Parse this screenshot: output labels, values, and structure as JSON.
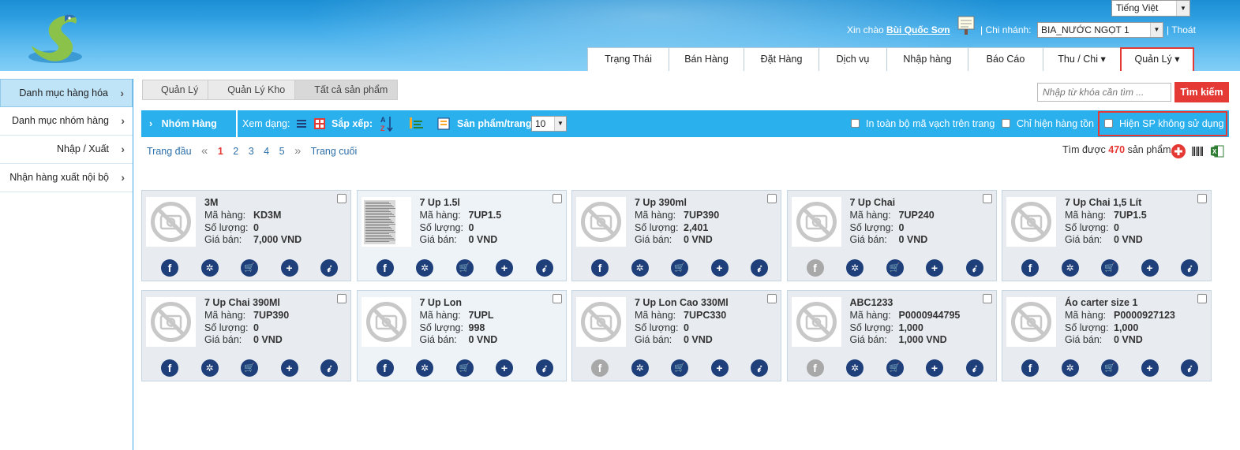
{
  "header": {
    "language": "Tiếng Việt",
    "greeting": "Xin chào",
    "user_name": "Bùi Quốc Sơn",
    "branch_label": "| Chi nhánh:",
    "branch_value": "BIA_NƯỚC NGỌT 1",
    "logout": "| Thoát"
  },
  "nav": {
    "tabs": [
      {
        "label": "Trạng Thái"
      },
      {
        "label": "Bán Hàng"
      },
      {
        "label": "Đặt Hàng"
      },
      {
        "label": "Dịch vụ"
      },
      {
        "label": "Nhập hàng"
      },
      {
        "label": "Báo Cáo"
      },
      {
        "label": "Thu / Chi ▾"
      },
      {
        "label": "Quản Lý ▾"
      }
    ]
  },
  "sidebar": {
    "items": [
      {
        "label": "Danh mục hàng hóa"
      },
      {
        "label": "Danh mục nhóm hàng"
      },
      {
        "label": "Nhập / Xuất"
      },
      {
        "label": "Nhận hàng xuất nội bộ"
      }
    ]
  },
  "breadcrumb": [
    "Quản Lý",
    "Quản Lý Kho",
    "Tất cả sản phẩm"
  ],
  "search": {
    "placeholder": "Nhập từ khóa cần tìm ...",
    "button": "Tìm kiếm"
  },
  "toolbar": {
    "group": "Nhóm Hàng",
    "view_label": "Xem dạng:",
    "sort_label": "Sắp xếp:",
    "per_page_label": "Sản phẩm/trang:",
    "per_page_value": "10",
    "print_all": "In toàn bộ mã vạch trên trang",
    "only_stock": "Chỉ hiện hàng tồn",
    "show_unused": "Hiện SP không sử dụng"
  },
  "pager": {
    "first": "Trang đầu",
    "prev": "«",
    "pages": [
      "1",
      "2",
      "3",
      "4",
      "5"
    ],
    "next": "»",
    "last": "Trang cuối"
  },
  "found": {
    "prefix": "Tìm được",
    "count": "470",
    "suffix": "sản phẩm"
  },
  "labels": {
    "code": "Mã hàng:",
    "qty": "Số lượng:",
    "price": "Giá bán:"
  },
  "products": [
    {
      "name": "3M",
      "code": "KD3M",
      "qty": "0",
      "price": "7,000 VND"
    },
    {
      "name": "7 Up 1.5l",
      "code": "7UP1.5",
      "qty": "0",
      "price": "0 VND"
    },
    {
      "name": "7 Up 390ml",
      "code": "7UP390",
      "qty": "2,401",
      "price": "0 VND"
    },
    {
      "name": "7 Up Chai",
      "code": "7UP240",
      "qty": "0",
      "price": "0 VND"
    },
    {
      "name": "7 Up Chai 1,5 Lít",
      "code": "7UP1.5",
      "qty": "0",
      "price": "0 VND"
    },
    {
      "name": "7 Up Chai 390Ml",
      "code": "7UP390",
      "qty": "0",
      "price": "0 VND"
    },
    {
      "name": "7 Up Lon",
      "code": "7UPL",
      "qty": "998",
      "price": "0 VND"
    },
    {
      "name": "7 Up Lon Cao 330Ml",
      "code": "7UPC330",
      "qty": "0",
      "price": "0 VND"
    },
    {
      "name": "ABC1233",
      "code": "P0000944795",
      "qty": "1,000",
      "price": "1,000 VND"
    },
    {
      "name": "Áo carter size 1",
      "code": "P0000927123",
      "qty": "1,000",
      "price": "0 VND"
    }
  ],
  "colors": {
    "accent": "#2bb0ee",
    "danger": "#e53935",
    "action_icon": "#1e3f7a"
  }
}
